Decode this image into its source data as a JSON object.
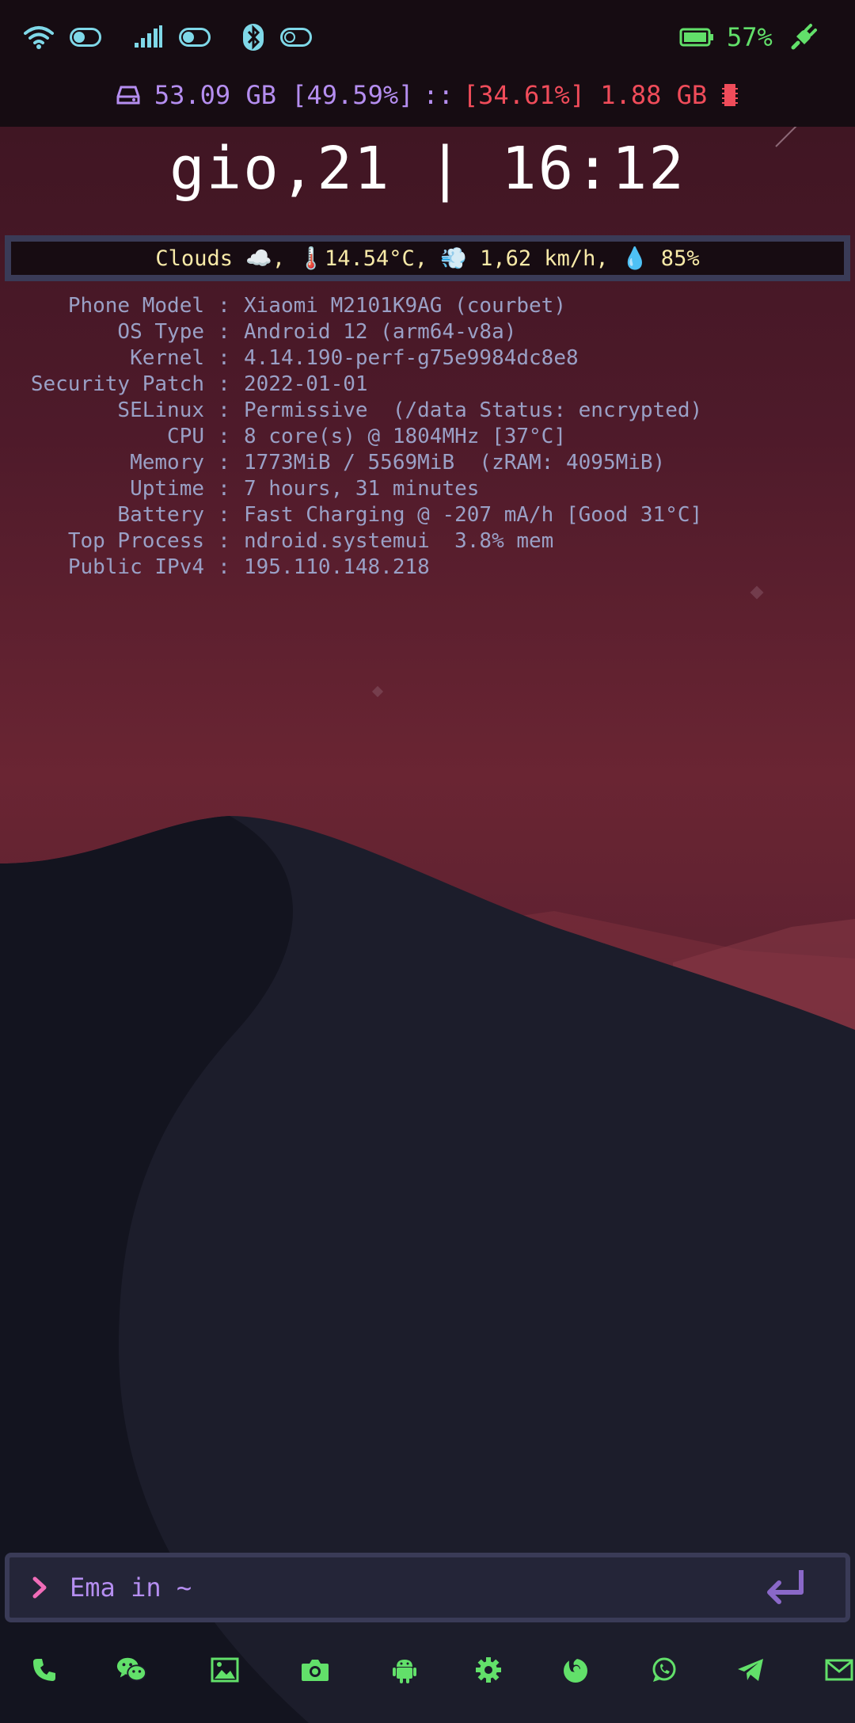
{
  "status_bar": {
    "battery_percent": "57%",
    "storage_text": "53.09 GB [49.59%]",
    "separator": "::",
    "ram_text": "[34.61%] 1.88 GB"
  },
  "clock": {
    "text": "gio,21 | 16:12"
  },
  "weather": {
    "text": "Clouds ☁️, 🌡️14.54°C, 💨 1,62 km/h, 💧 85%"
  },
  "system_info": [
    {
      "key": "Phone Model",
      "value": "Xiaomi M2101K9AG (courbet)"
    },
    {
      "key": "OS Type",
      "value": "Android 12 (arm64-v8a)"
    },
    {
      "key": "Kernel",
      "value": "4.14.190-perf-g75e9984dc8e8"
    },
    {
      "key": "Security Patch",
      "value": "2022-01-01"
    },
    {
      "key": "SELinux",
      "value": "Permissive  (/data Status: encrypted)"
    },
    {
      "key": "CPU",
      "value": "8 core(s) @ 1804MHz [37°C]"
    },
    {
      "key": "Memory",
      "value": "1773MiB / 5569MiB  (zRAM: 4095MiB)"
    },
    {
      "key": "Uptime",
      "value": "7 hours, 31 minutes"
    },
    {
      "key": "Battery",
      "value": "Fast Charging @ -207 mA/h [Good 31°C]"
    },
    {
      "key": "Top Process",
      "value": "ndroid.systemui  3.8% mem"
    },
    {
      "key": "Public IPv4",
      "value": "195.110.148.218"
    }
  ],
  "command_input": {
    "prompt_text": "Ema in ~"
  },
  "dock": {
    "icons": [
      "phone-icon",
      "wechat-icon",
      "gallery-icon",
      "camera-icon",
      "android-icon",
      "settings-icon",
      "firefox-icon",
      "whatsapp-icon",
      "telegram-icon",
      "mail-icon"
    ]
  },
  "colors": {
    "accent_green": "#62e06a",
    "accent_cyan": "#7fd8e8",
    "accent_purple": "#b58ef0",
    "accent_red": "#f04c5a",
    "weather_text": "#f8eaa8",
    "info_text": "#9aa0c6"
  }
}
